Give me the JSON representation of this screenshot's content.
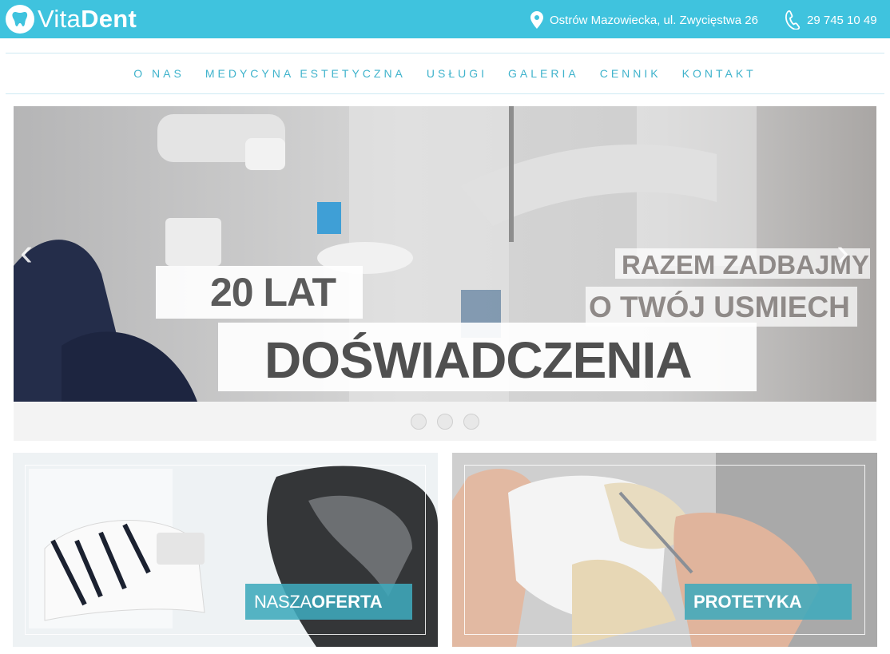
{
  "header": {
    "logo": {
      "part1": "Vita",
      "part2": "Dent",
      "icon": "tooth-icon"
    },
    "address": {
      "text": "Ostrów Mazowiecka, ul. Zwycięstwa 26",
      "icon": "map-pin-icon"
    },
    "phone": {
      "text": "29 745 10 49",
      "icon": "phone-icon"
    },
    "colors": {
      "bar": "#3fc3de",
      "text": "#ffffff"
    }
  },
  "nav": {
    "items": [
      {
        "label": "O NAS"
      },
      {
        "label": "MEDYCYNA ESTETYCZNA"
      },
      {
        "label": "USŁUGI"
      },
      {
        "label": "GALERIA"
      },
      {
        "label": "CENNIK"
      },
      {
        "label": "KONTAKT"
      }
    ],
    "color": "#3fb3cc"
  },
  "slider": {
    "line1": "20 LAT",
    "line2": "DOŚWIADCZENIA",
    "line3": "RAZEM ZADBAJMY",
    "line4": "O TWÓJ USMIECH",
    "prev": "‹",
    "next": "›",
    "dots": 3
  },
  "tiles": [
    {
      "label_thin": "NASZA",
      "label_bold": "OFERTA"
    },
    {
      "label_thin": "",
      "label_bold": "PROTETYKA"
    }
  ]
}
